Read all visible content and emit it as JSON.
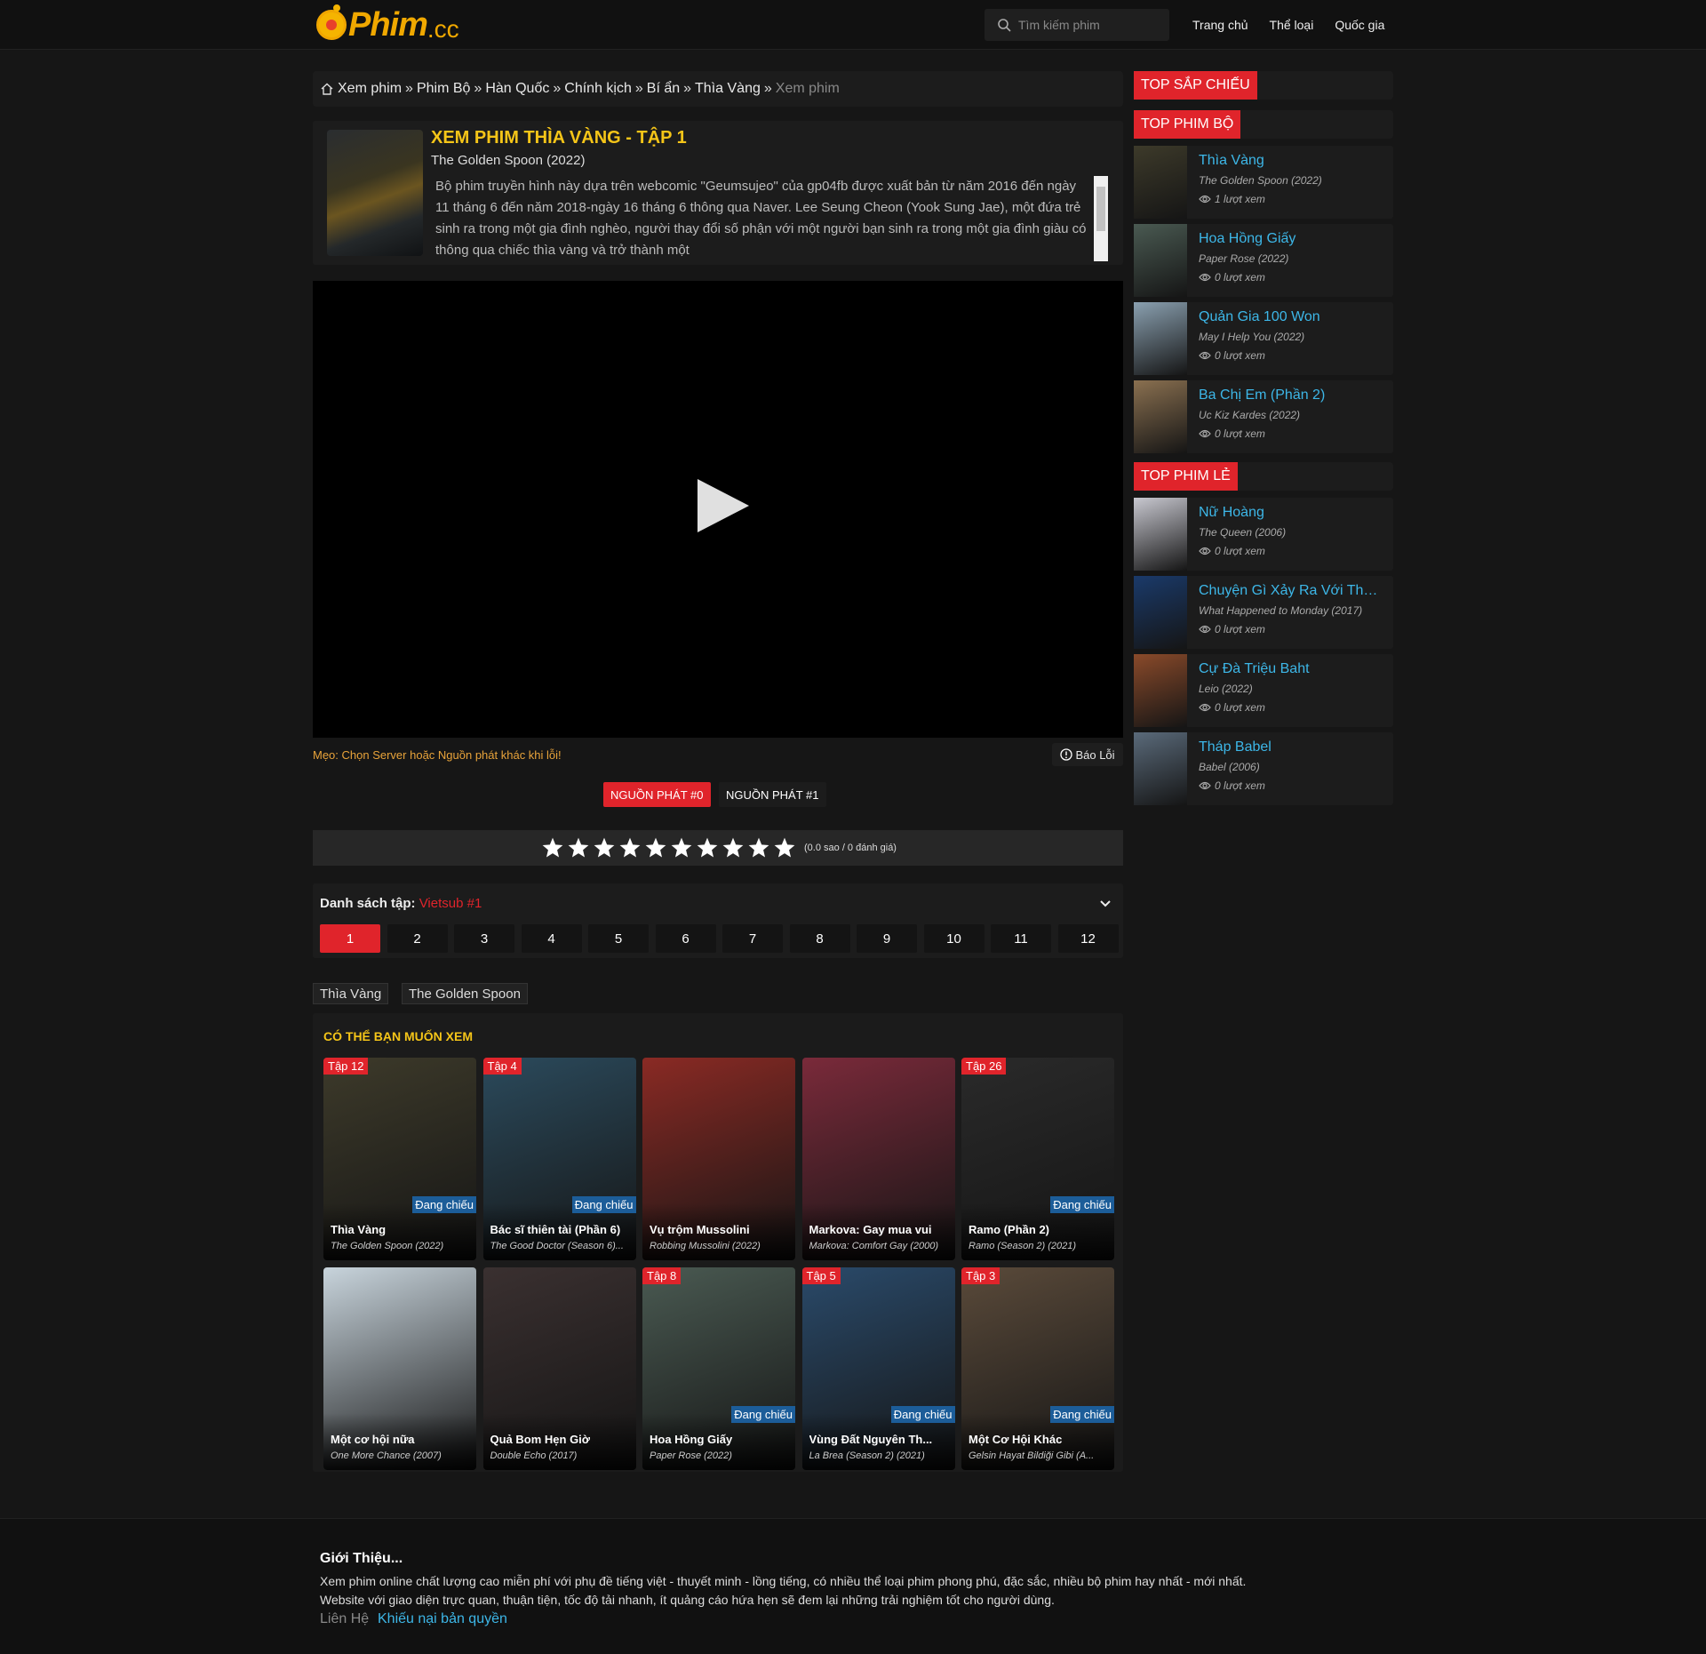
{
  "header": {
    "logo_text": "Phim",
    "logo_suffix": ".cc",
    "search_placeholder": "Tìm kiếm phim",
    "nav": [
      "Trang chủ",
      "Thể loại",
      "Quốc gia"
    ]
  },
  "breadcrumb": {
    "items": [
      "Xem phim",
      "Phim Bộ",
      "Hàn Quốc",
      "Chính kịch",
      "Bí ẩn",
      "Thìa Vàng"
    ],
    "separator": "»",
    "current": "Xem phim"
  },
  "movie": {
    "title": "XEM PHIM THÌA VÀNG - TẬP 1",
    "original": "The Golden Spoon (2022)",
    "description": "Bộ phim truyền hình này dựa trên webcomic \"Geumsujeo\" của gp04fb được xuất bản từ năm 2016 đến ngày 11 tháng 6 đến năm 2018-ngày 16 tháng 6 thông qua Naver. Lee Seung Cheon (Yook Sung Jae), một đứa trẻ sinh ra trong một gia đình nghèo, người thay đổi số phận với một người bạn sinh ra trong một gia đình giàu có thông qua chiếc thìa vàng và trở thành một"
  },
  "player": {
    "tip": "Mẹo: Chọn Server hoặc Nguồn phát khác khi lỗi!",
    "report": "Báo Lỗi",
    "sources": [
      "NGUỒN PHÁT #0",
      "NGUỒN PHÁT #1"
    ],
    "active_source": 0
  },
  "rating": {
    "stars": 10,
    "text": "(0.0 sao / 0 đánh giá)"
  },
  "episodes": {
    "label": "Danh sách tập:",
    "server": "Vietsub #1",
    "list": [
      "1",
      "2",
      "3",
      "4",
      "5",
      "6",
      "7",
      "8",
      "9",
      "10",
      "11",
      "12"
    ],
    "active": "1"
  },
  "tags": [
    "Thìa Vàng",
    "The Golden Spoon"
  ],
  "recommend": {
    "heading": "CÓ THỂ BẠN MUỐN XEM",
    "items": [
      {
        "title": "Thìa Vàng",
        "sub": "The Golden Spoon (2022)",
        "ep": "Tập 12",
        "status": "Đang chiếu",
        "color": "#3d3a2a"
      },
      {
        "title": "Bác sĩ thiên tài (Phần 6)",
        "sub": "The Good Doctor (Season 6)...",
        "ep": "Tập 4",
        "status": "Đang chiếu",
        "color": "#2b4a5c"
      },
      {
        "title": "Vụ trộm Mussolini",
        "sub": "Robbing Mussolini (2022)",
        "ep": "",
        "status": "",
        "color": "#8a2a24"
      },
      {
        "title": "Markova: Gay mua vui",
        "sub": "Markova: Comfort Gay (2000)",
        "ep": "",
        "status": "",
        "color": "#7a2a3a"
      },
      {
        "title": "Ramo (Phần 2)",
        "sub": "Ramo (Season 2) (2021)",
        "ep": "Tập 26",
        "status": "Đang chiếu",
        "color": "#2a2a2a"
      },
      {
        "title": "Một cơ hội nữa",
        "sub": "One More Chance (2007)",
        "ep": "",
        "status": "",
        "color": "#c8d4dc"
      },
      {
        "title": "Quả Bom Hẹn Giờ",
        "sub": "Double Echo (2017)",
        "ep": "",
        "status": "",
        "color": "#3a3030"
      },
      {
        "title": "Hoa Hồng Giấy",
        "sub": "Paper Rose (2022)",
        "ep": "Tập 8",
        "status": "Đang chiếu",
        "color": "#4a5a52"
      },
      {
        "title": "Vùng Đất Nguyên Th...",
        "sub": "La Brea (Season 2) (2021)",
        "ep": "Tập 5",
        "status": "Đang chiếu",
        "color": "#2a4a6a"
      },
      {
        "title": "Một Cơ Hội Khác",
        "sub": "Gelsin Hayat Bildiği Gibi (A...",
        "ep": "Tập 3",
        "status": "Đang chiếu",
        "color": "#5a4a3a"
      }
    ]
  },
  "sidebar": {
    "upcoming_heading": "TOP SẮP CHIẾU",
    "series_heading": "TOP PHIM BỘ",
    "movies_heading": "TOP PHIM LẺ",
    "series": [
      {
        "title": "Thìa Vàng",
        "orig": "The Golden Spoon (2022)",
        "views": "1 lượt xem",
        "color": "#3d3a2a"
      },
      {
        "title": "Hoa Hồng Giấy",
        "orig": "Paper Rose (2022)",
        "views": "0 lượt xem",
        "color": "#4a5a52"
      },
      {
        "title": "Quản Gia 100 Won",
        "orig": "May I Help You (2022)",
        "views": "0 lượt xem",
        "color": "#8aa0b0"
      },
      {
        "title": "Ba Chị Em (Phần 2)",
        "orig": "Uc Kiz Kardes (2022)",
        "views": "0 lượt xem",
        "color": "#8a7050"
      }
    ],
    "movies": [
      {
        "title": "Nữ Hoàng",
        "orig": "The Queen (2006)",
        "views": "0 lượt xem",
        "color": "#c8c8d0"
      },
      {
        "title": "Chuyện Gì Xảy Ra Với Thứ ...",
        "orig": "What Happened to Monday (2017)",
        "views": "0 lượt xem",
        "color": "#1a3a6a"
      },
      {
        "title": "Cự Đà Triệu Baht",
        "orig": "Leio (2022)",
        "views": "0 lượt xem",
        "color": "#8a4a2a"
      },
      {
        "title": "Tháp Babel",
        "orig": "Babel (2006)",
        "views": "0 lượt xem",
        "color": "#5a6a7a"
      }
    ]
  },
  "footer": {
    "heading": "Giới Thiệu...",
    "line1": "Xem phim online chất lượng cao miễn phí với phụ đề tiếng việt - thuyết minh - lồng tiếng, có nhiều thể loại phim phong phú, đặc sắc, nhiều bộ phim hay nhất - mới nhất.",
    "line2": "Website với giao diện trực quan, thuận tiện, tốc độ tải nhanh, ít quảng cáo hứa hẹn sẽ đem lại những trải nghiệm tốt cho người dùng.",
    "contact": "Liên Hệ",
    "copyright": "Khiếu nại bản quyền"
  }
}
